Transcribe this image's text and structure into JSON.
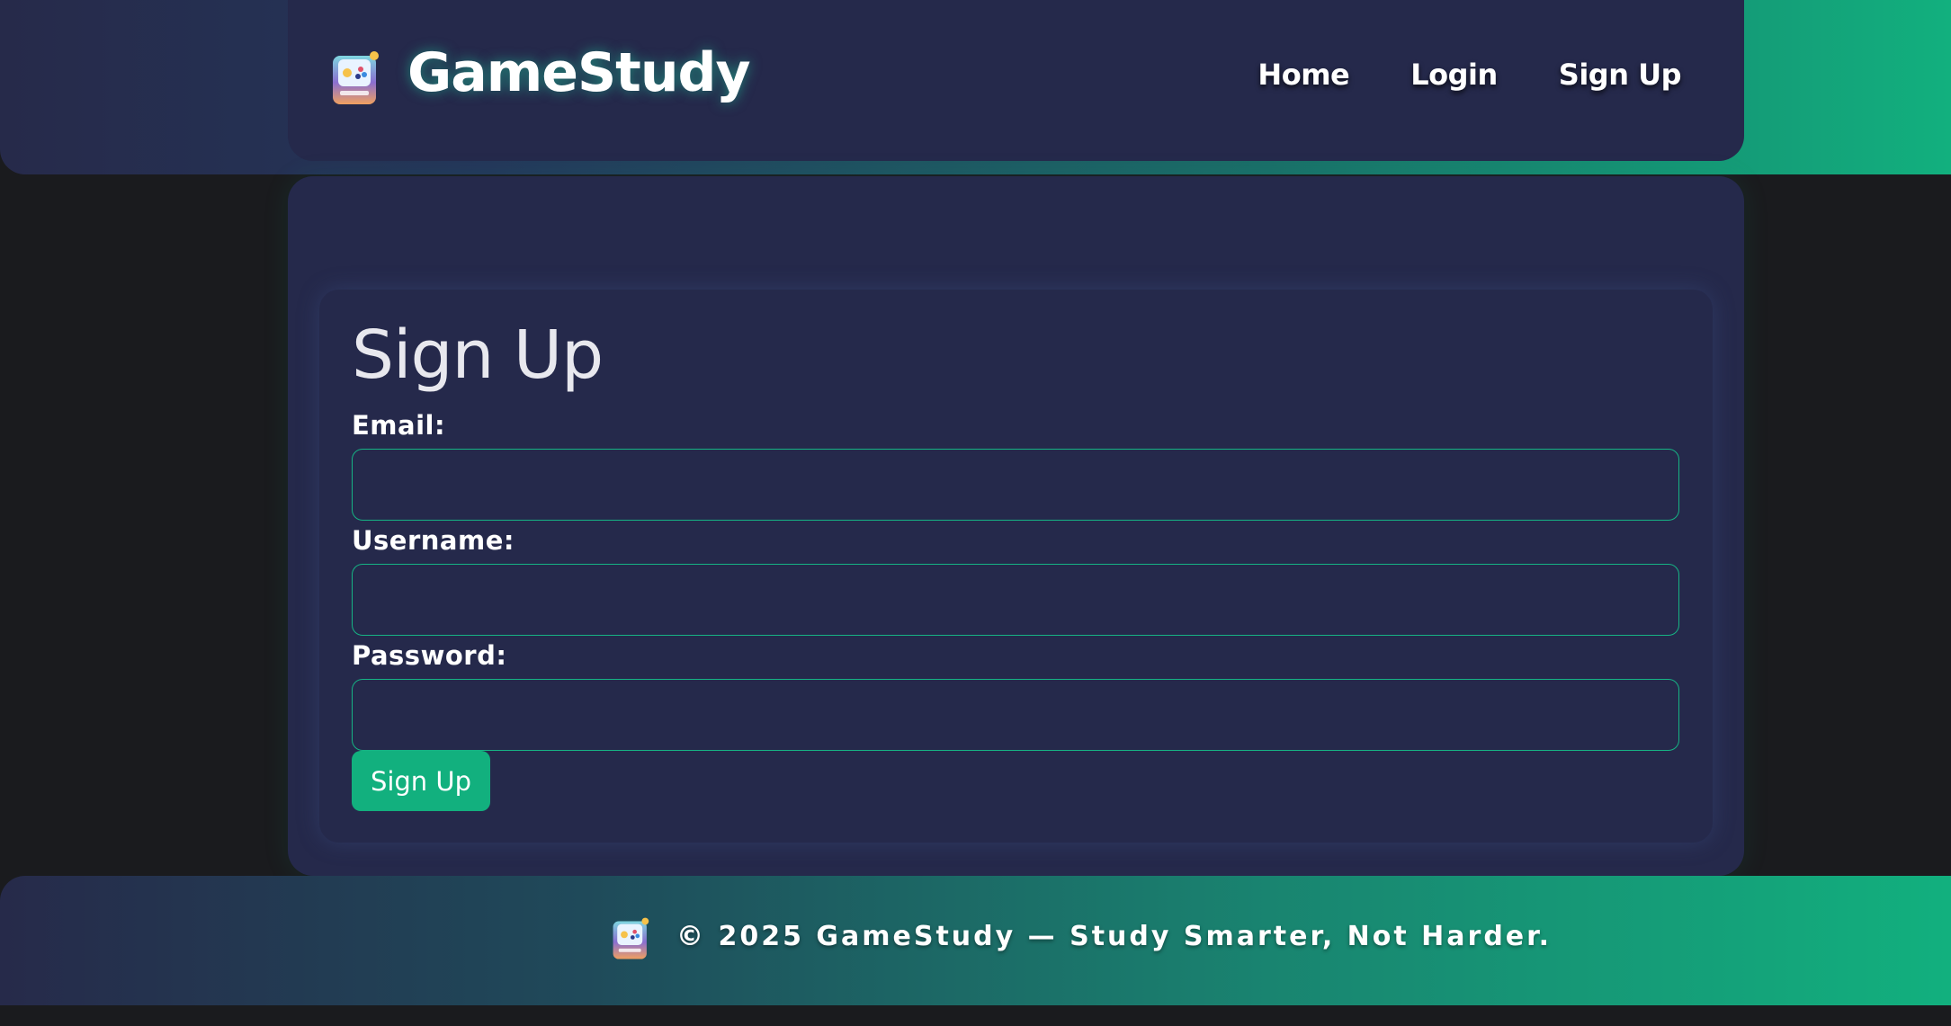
{
  "header": {
    "brand": "GameStudy",
    "nav": [
      {
        "label": "Home"
      },
      {
        "label": "Login"
      },
      {
        "label": "Sign Up"
      }
    ]
  },
  "form": {
    "title": "Sign Up",
    "fields": [
      {
        "label": "Email:",
        "value": "",
        "placeholder": ""
      },
      {
        "label": "Username:",
        "value": "",
        "placeholder": ""
      },
      {
        "label": "Password:",
        "value": "",
        "placeholder": ""
      }
    ],
    "submit_label": "Sign Up"
  },
  "footer": {
    "text": "© 2025 GameStudy — Study Smarter, Not Harder."
  },
  "colors": {
    "accent": "#12b07e",
    "card_bg": "#25294b",
    "page_bg": "#1a1b1e"
  },
  "icons": {
    "logo": "gamepad-logo-icon"
  }
}
